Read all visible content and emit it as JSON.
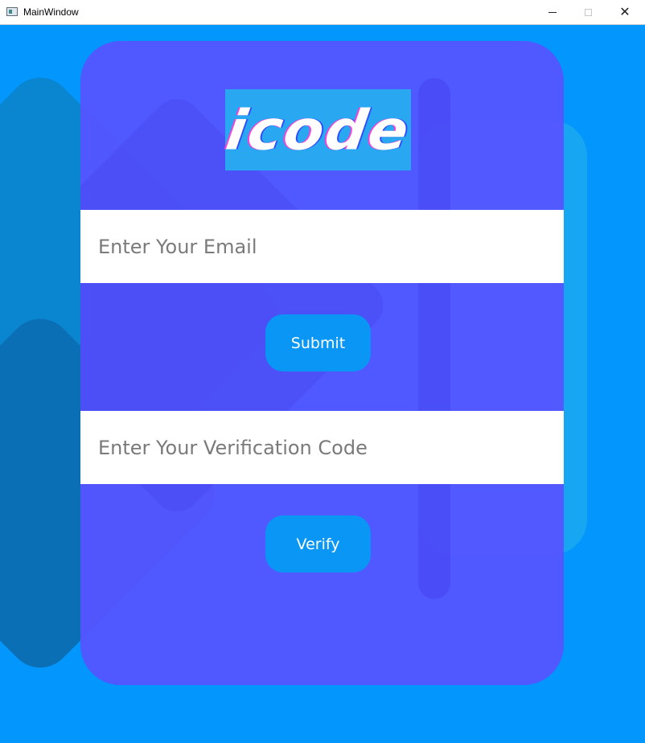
{
  "window": {
    "title": "MainWindow",
    "controls": {
      "minimize": "minimize",
      "maximize": "maximize",
      "close": "✕"
    }
  },
  "logo": {
    "text": "icode"
  },
  "email": {
    "placeholder": "Enter Your Email"
  },
  "submit": {
    "label": "Submit"
  },
  "code": {
    "placeholder": "Enter Your Verification Code"
  },
  "verify": {
    "label": "Verify"
  },
  "colors": {
    "background": "#0396fc",
    "panel": "#5454ff",
    "button": "#0a96f4",
    "logo_bg": "#29a7f0"
  }
}
